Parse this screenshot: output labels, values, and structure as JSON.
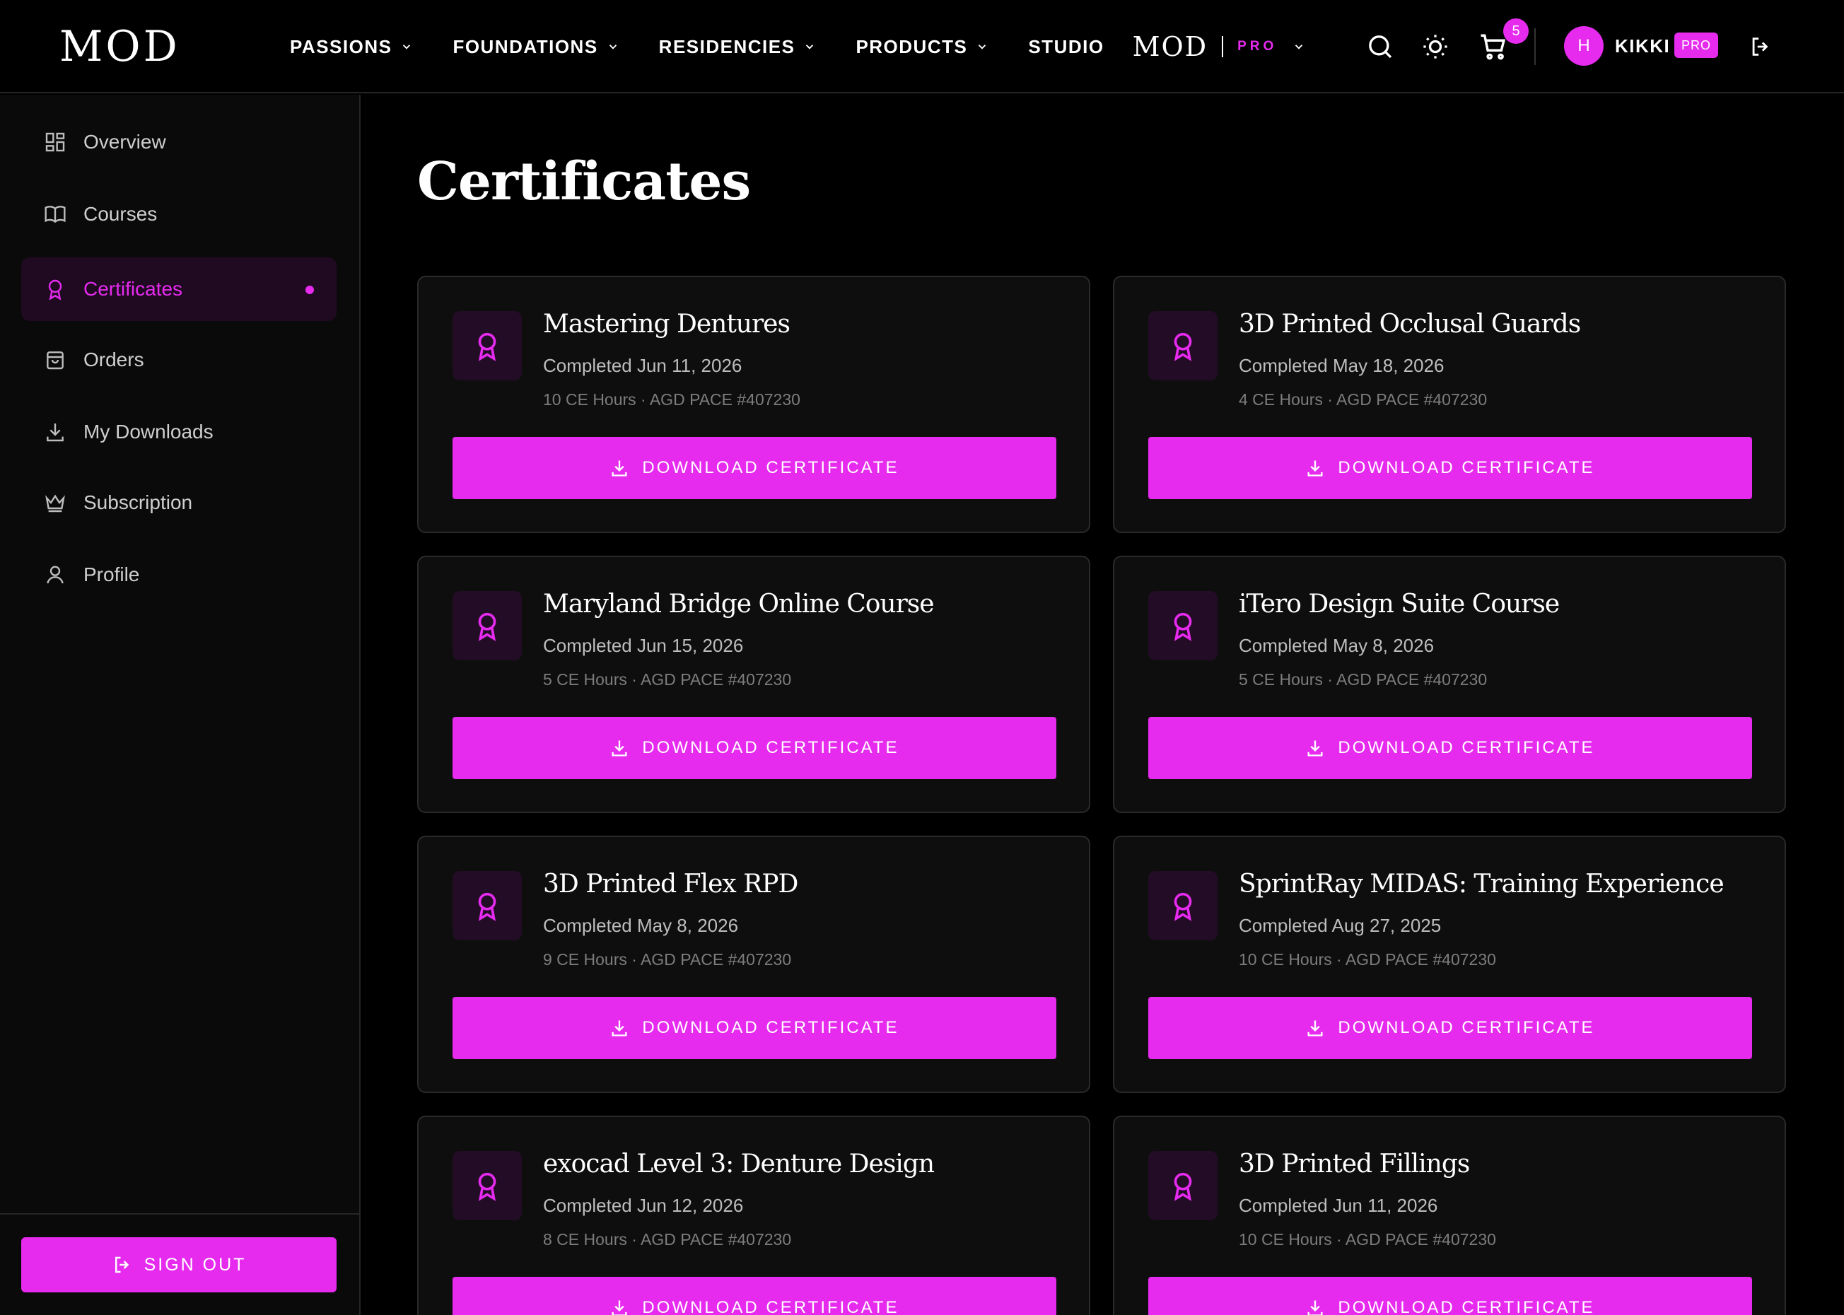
{
  "header": {
    "logo": "MOD",
    "nav": [
      {
        "label": "PASSIONS"
      },
      {
        "label": "FOUNDATIONS"
      },
      {
        "label": "RESIDENCIES"
      },
      {
        "label": "PRODUCTS"
      },
      {
        "label": "STUDIO"
      }
    ],
    "pro_logo": "MOD",
    "pro_label": "PRO",
    "cart_count": "5",
    "user_initial": "H",
    "user_name": "KIKKI",
    "user_badge": "PRO"
  },
  "sidebar": {
    "items": [
      {
        "label": "Overview",
        "icon": "grid-icon"
      },
      {
        "label": "Courses",
        "icon": "book-icon"
      },
      {
        "label": "Certificates",
        "icon": "award-icon",
        "active": true
      },
      {
        "label": "Orders",
        "icon": "bag-icon"
      },
      {
        "label": "My Downloads",
        "icon": "download-icon"
      },
      {
        "label": "Subscription",
        "icon": "crown-icon"
      },
      {
        "label": "Profile",
        "icon": "user-icon"
      }
    ],
    "sign_out": "SIGN OUT"
  },
  "main": {
    "title": "Certificates",
    "download_label": "DOWNLOAD CERTIFICATE",
    "certificates": [
      {
        "title": "Mastering Dentures",
        "completed": "Completed Jun 11, 2026",
        "meta": "10 CE Hours · AGD PACE #407230"
      },
      {
        "title": "3D Printed Occlusal Guards",
        "completed": "Completed May 18, 2026",
        "meta": "4 CE Hours · AGD PACE #407230"
      },
      {
        "title": "Maryland Bridge Online Course",
        "completed": "Completed Jun 15, 2026",
        "meta": "5 CE Hours · AGD PACE #407230"
      },
      {
        "title": "iTero Design Suite Course",
        "completed": "Completed May 8, 2026",
        "meta": "5 CE Hours · AGD PACE #407230"
      },
      {
        "title": "3D Printed Flex RPD",
        "completed": "Completed May 8, 2026",
        "meta": "9 CE Hours · AGD PACE #407230"
      },
      {
        "title": "SprintRay MIDAS: Training Experience",
        "completed": "Completed Aug 27, 2025",
        "meta": "10 CE Hours · AGD PACE #407230"
      },
      {
        "title": "exocad Level 3: Denture Design",
        "completed": "Completed Jun 12, 2026",
        "meta": "8 CE Hours · AGD PACE #407230"
      },
      {
        "title": "3D Printed Fillings",
        "completed": "Completed Jun 11, 2026",
        "meta": "10 CE Hours · AGD PACE #407230"
      }
    ]
  },
  "colors": {
    "accent": "#e62bef",
    "background": "#000000",
    "card": "#0e0e0e"
  }
}
